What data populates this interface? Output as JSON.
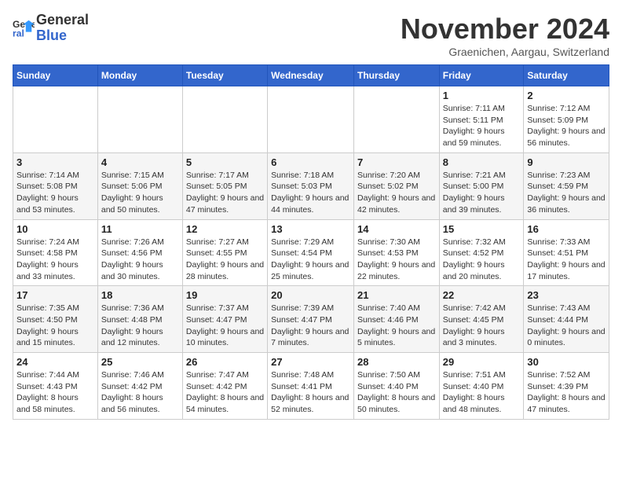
{
  "header": {
    "logo_line1": "General",
    "logo_line2": "Blue",
    "month": "November 2024",
    "location": "Graenichen, Aargau, Switzerland"
  },
  "days_of_week": [
    "Sunday",
    "Monday",
    "Tuesday",
    "Wednesday",
    "Thursday",
    "Friday",
    "Saturday"
  ],
  "weeks": [
    [
      {
        "day": "",
        "info": ""
      },
      {
        "day": "",
        "info": ""
      },
      {
        "day": "",
        "info": ""
      },
      {
        "day": "",
        "info": ""
      },
      {
        "day": "",
        "info": ""
      },
      {
        "day": "1",
        "info": "Sunrise: 7:11 AM\nSunset: 5:11 PM\nDaylight: 9 hours and 59 minutes."
      },
      {
        "day": "2",
        "info": "Sunrise: 7:12 AM\nSunset: 5:09 PM\nDaylight: 9 hours and 56 minutes."
      }
    ],
    [
      {
        "day": "3",
        "info": "Sunrise: 7:14 AM\nSunset: 5:08 PM\nDaylight: 9 hours and 53 minutes."
      },
      {
        "day": "4",
        "info": "Sunrise: 7:15 AM\nSunset: 5:06 PM\nDaylight: 9 hours and 50 minutes."
      },
      {
        "day": "5",
        "info": "Sunrise: 7:17 AM\nSunset: 5:05 PM\nDaylight: 9 hours and 47 minutes."
      },
      {
        "day": "6",
        "info": "Sunrise: 7:18 AM\nSunset: 5:03 PM\nDaylight: 9 hours and 44 minutes."
      },
      {
        "day": "7",
        "info": "Sunrise: 7:20 AM\nSunset: 5:02 PM\nDaylight: 9 hours and 42 minutes."
      },
      {
        "day": "8",
        "info": "Sunrise: 7:21 AM\nSunset: 5:00 PM\nDaylight: 9 hours and 39 minutes."
      },
      {
        "day": "9",
        "info": "Sunrise: 7:23 AM\nSunset: 4:59 PM\nDaylight: 9 hours and 36 minutes."
      }
    ],
    [
      {
        "day": "10",
        "info": "Sunrise: 7:24 AM\nSunset: 4:58 PM\nDaylight: 9 hours and 33 minutes."
      },
      {
        "day": "11",
        "info": "Sunrise: 7:26 AM\nSunset: 4:56 PM\nDaylight: 9 hours and 30 minutes."
      },
      {
        "day": "12",
        "info": "Sunrise: 7:27 AM\nSunset: 4:55 PM\nDaylight: 9 hours and 28 minutes."
      },
      {
        "day": "13",
        "info": "Sunrise: 7:29 AM\nSunset: 4:54 PM\nDaylight: 9 hours and 25 minutes."
      },
      {
        "day": "14",
        "info": "Sunrise: 7:30 AM\nSunset: 4:53 PM\nDaylight: 9 hours and 22 minutes."
      },
      {
        "day": "15",
        "info": "Sunrise: 7:32 AM\nSunset: 4:52 PM\nDaylight: 9 hours and 20 minutes."
      },
      {
        "day": "16",
        "info": "Sunrise: 7:33 AM\nSunset: 4:51 PM\nDaylight: 9 hours and 17 minutes."
      }
    ],
    [
      {
        "day": "17",
        "info": "Sunrise: 7:35 AM\nSunset: 4:50 PM\nDaylight: 9 hours and 15 minutes."
      },
      {
        "day": "18",
        "info": "Sunrise: 7:36 AM\nSunset: 4:48 PM\nDaylight: 9 hours and 12 minutes."
      },
      {
        "day": "19",
        "info": "Sunrise: 7:37 AM\nSunset: 4:47 PM\nDaylight: 9 hours and 10 minutes."
      },
      {
        "day": "20",
        "info": "Sunrise: 7:39 AM\nSunset: 4:47 PM\nDaylight: 9 hours and 7 minutes."
      },
      {
        "day": "21",
        "info": "Sunrise: 7:40 AM\nSunset: 4:46 PM\nDaylight: 9 hours and 5 minutes."
      },
      {
        "day": "22",
        "info": "Sunrise: 7:42 AM\nSunset: 4:45 PM\nDaylight: 9 hours and 3 minutes."
      },
      {
        "day": "23",
        "info": "Sunrise: 7:43 AM\nSunset: 4:44 PM\nDaylight: 9 hours and 0 minutes."
      }
    ],
    [
      {
        "day": "24",
        "info": "Sunrise: 7:44 AM\nSunset: 4:43 PM\nDaylight: 8 hours and 58 minutes."
      },
      {
        "day": "25",
        "info": "Sunrise: 7:46 AM\nSunset: 4:42 PM\nDaylight: 8 hours and 56 minutes."
      },
      {
        "day": "26",
        "info": "Sunrise: 7:47 AM\nSunset: 4:42 PM\nDaylight: 8 hours and 54 minutes."
      },
      {
        "day": "27",
        "info": "Sunrise: 7:48 AM\nSunset: 4:41 PM\nDaylight: 8 hours and 52 minutes."
      },
      {
        "day": "28",
        "info": "Sunrise: 7:50 AM\nSunset: 4:40 PM\nDaylight: 8 hours and 50 minutes."
      },
      {
        "day": "29",
        "info": "Sunrise: 7:51 AM\nSunset: 4:40 PM\nDaylight: 8 hours and 48 minutes."
      },
      {
        "day": "30",
        "info": "Sunrise: 7:52 AM\nSunset: 4:39 PM\nDaylight: 8 hours and 47 minutes."
      }
    ]
  ]
}
